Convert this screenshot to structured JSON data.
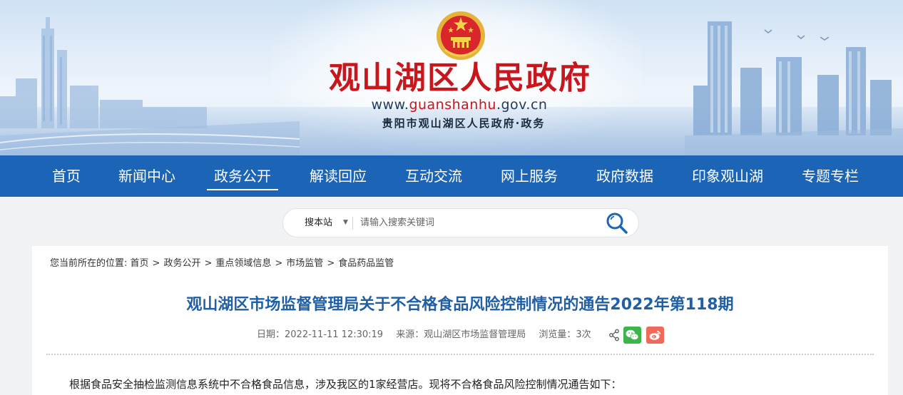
{
  "header": {
    "site_title": "观山湖区人民政府",
    "url_prefix": "www.",
    "url_domain": "guanshanhu",
    "url_suffix": ".gov.cn",
    "subtitle": "贵阳市观山湖区人民政府·政务"
  },
  "nav": {
    "items": [
      {
        "label": "首页"
      },
      {
        "label": "新闻中心"
      },
      {
        "label": "政务公开",
        "active": true
      },
      {
        "label": "解读回应"
      },
      {
        "label": "互动交流"
      },
      {
        "label": "网上服务"
      },
      {
        "label": "政府数据"
      },
      {
        "label": "印象观山湖"
      },
      {
        "label": "专题专栏"
      }
    ]
  },
  "search": {
    "scope": "搜本站",
    "caret": "▼",
    "placeholder": "请输入搜索关键词",
    "value": ""
  },
  "breadcrumb": {
    "prefix": "您当前所在的位置:",
    "items": [
      "首页",
      "政务公开",
      "重点领域信息",
      "市场监管",
      "食品药品监管"
    ],
    "separator": ">"
  },
  "article": {
    "title": "观山湖区市场监督管理局关于不合格食品风险控制情况的通告2022年第118期",
    "date": "日期：2022-11-11 12:30:19",
    "source": "来源：观山湖区市场监督管理局",
    "views": "浏览量：3次",
    "body_first_line": "根据食品安全抽检监测信息系统中不合格食品信息，涉及我区的1家经营店。现将不合格食品风险控制情况通告如下："
  },
  "colors": {
    "nav_bg": "#1c64b5",
    "title_red": "#c8161d",
    "article_title_blue": "#1f5fa6",
    "wechat": "#3bb54a",
    "weibo": "#ef6a5a"
  },
  "icons": [
    "national-emblem-icon",
    "search-icon",
    "share-icon",
    "wechat-icon",
    "weibo-icon"
  ]
}
